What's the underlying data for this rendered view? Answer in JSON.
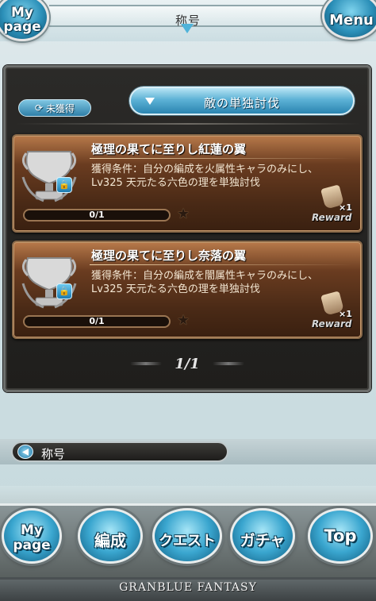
{
  "header": {
    "title": "称号",
    "mypage_label": "My page",
    "menu_label": "Menu"
  },
  "filters": {
    "unacquired_label": "未獲得",
    "select_value": "敵の単独討伐"
  },
  "titles": [
    {
      "name": "極理の果てに至りし紅蓮の翼",
      "condition_line1": "獲得条件：自分の編成を火属性キャラのみにし、",
      "condition_line2": "Lv325 天元たる六色の理を単独討伐",
      "progress_text": "0/1",
      "progress_fraction": 0,
      "reward_count": "×1",
      "reward_label": "Reward"
    },
    {
      "name": "極理の果てに至りし奈落の翼",
      "condition_line1": "獲得条件：自分の編成を闇属性キャラのみにし、",
      "condition_line2": "Lv325 天元たる六色の理を単独討伐",
      "progress_text": "0/1",
      "progress_fraction": 0,
      "reward_count": "×1",
      "reward_label": "Reward"
    }
  ],
  "pager": {
    "text": "1/1"
  },
  "breadcrumb": {
    "label": "称号"
  },
  "footer": {
    "mypage": "My page",
    "party": "編成",
    "quest": "クエスト",
    "gacha": "ガチャ",
    "top": "Top",
    "logo": "GRANBLUE FANTASY"
  },
  "colors": {
    "accent": "#3aa6cf",
    "card": "#6a3c20",
    "panel": "#1f1e1c"
  }
}
